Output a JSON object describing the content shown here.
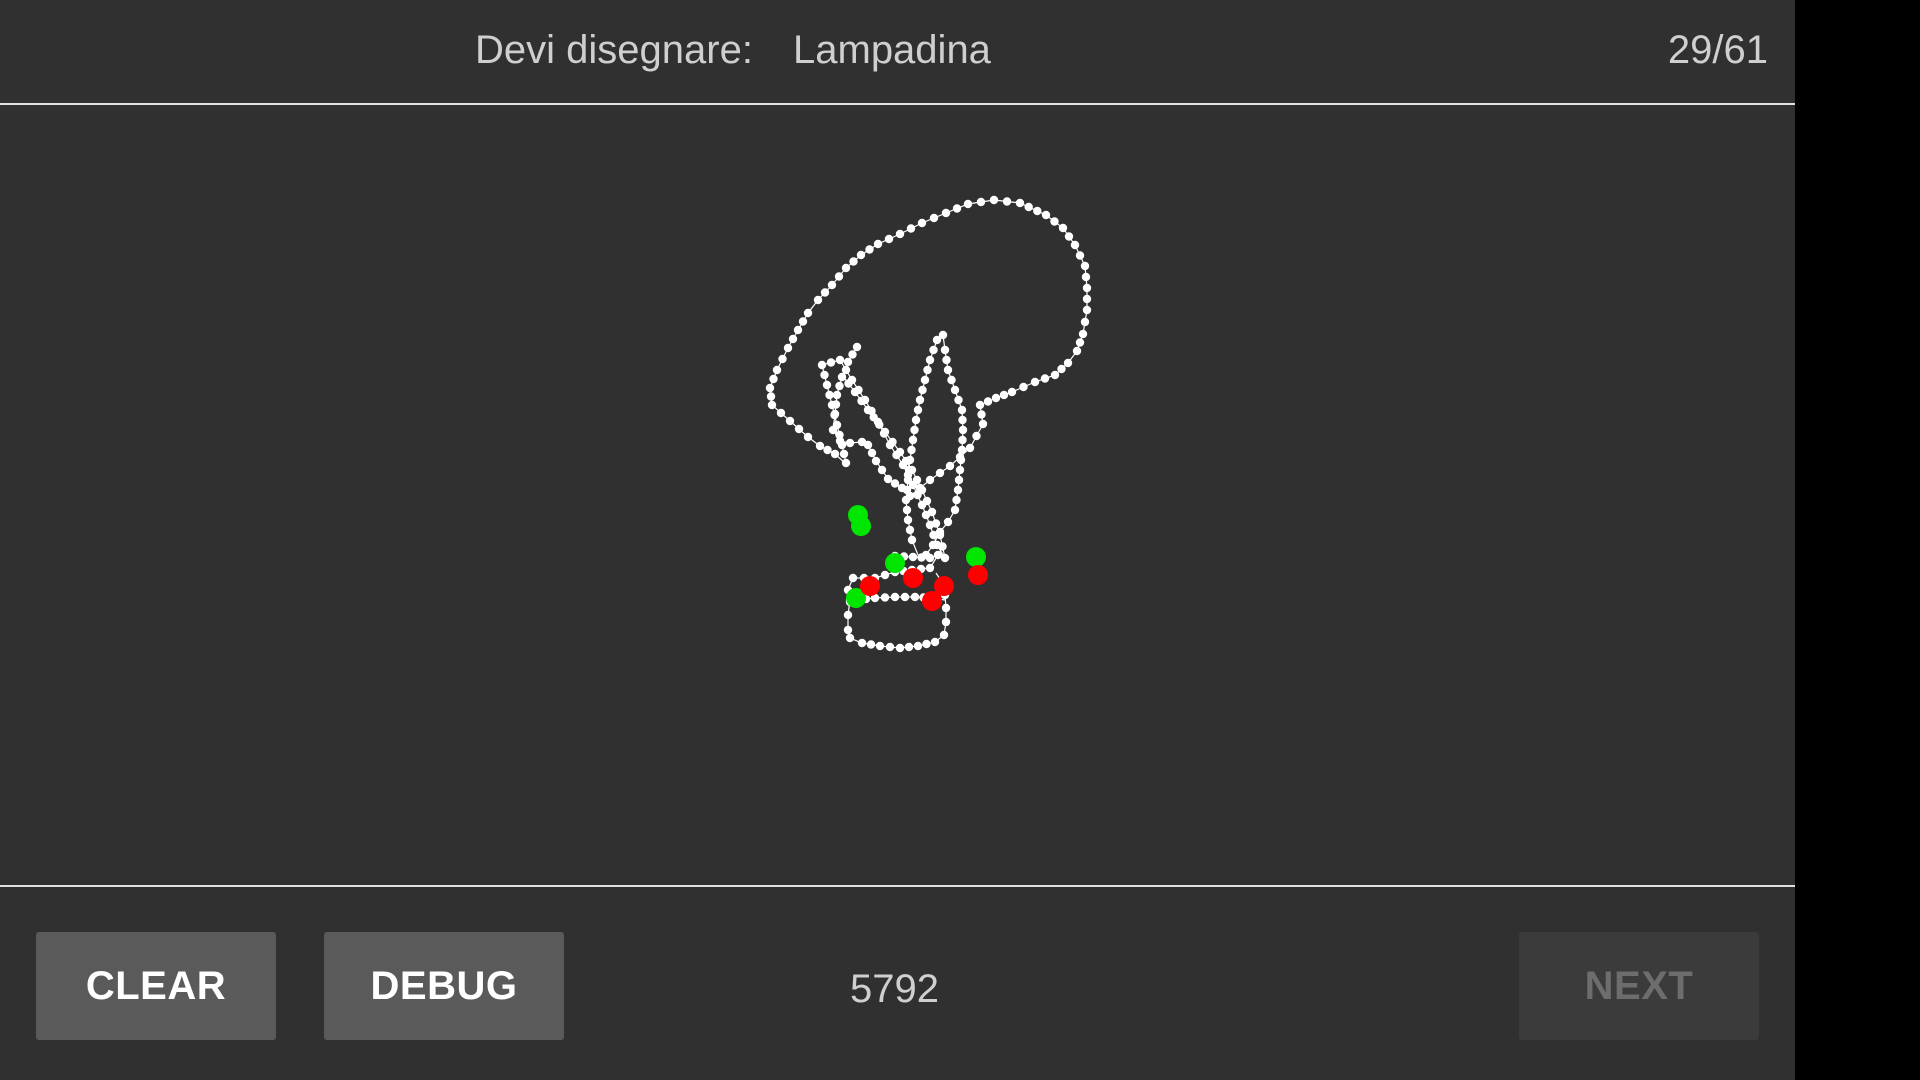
{
  "header": {
    "prompt_label": "Devi disegnare:",
    "target_word": "Lampadina",
    "counter": "29/61"
  },
  "footer": {
    "clear_label": "CLEAR",
    "debug_label": "DEBUG",
    "score": "5792",
    "next_label": "NEXT",
    "next_enabled": false
  },
  "colors": {
    "background": "#303030",
    "stroke": "#ffffff",
    "match_point": "#00e600",
    "miss_point": "#ff0000",
    "disabled_button": "#3b3b3b"
  },
  "canvas": {
    "content": "white dotted stroke drawing of a light bulb with green and red marker dots"
  }
}
